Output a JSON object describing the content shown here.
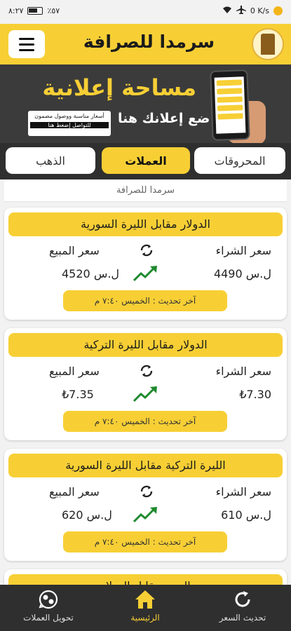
{
  "status_bar": {
    "time": "٨:٢٧",
    "battery": "٪٥٧",
    "speed": "0 K/s"
  },
  "app_bar": {
    "title": "سرمدا للصرافة"
  },
  "ad": {
    "headline": "مساحة إعلانية",
    "cta": "ضع إعلانك هنا",
    "small_line1": "أسعار مناسبة ووصول مضمون",
    "small_line2": "للتواصل إضغط هنا"
  },
  "tabs": [
    {
      "label": "المحروقات"
    },
    {
      "label": "العملات"
    },
    {
      "label": "الذهب"
    }
  ],
  "subheader": "سرمدا للصرافة",
  "labels": {
    "buy": "سعر الشراء",
    "sell": "سعر المبيع"
  },
  "cards": [
    {
      "title": "الدولار مقابل الليرة السورية",
      "buy": "4490 ل.س",
      "sell": "4520 ل.س",
      "updated": "آخر تحديث : الخميس ٧:٤٠ م"
    },
    {
      "title": "الدولار مقابل الليرة التركية",
      "buy": "₺7.30",
      "sell": "₺7.35",
      "updated": "آخر تحديث : الخميس ٧:٤٠ م"
    },
    {
      "title": "الليرة التركية مقابل الليرة السورية",
      "buy": "610 ل.س",
      "sell": "620 ل.س",
      "updated": "آخر تحديث : الخميس ٧:٤٠ م"
    },
    {
      "title": "اليورو مقابل الدولار",
      "buy": "",
      "sell": "",
      "updated": ""
    }
  ],
  "bottom_nav": [
    {
      "label": "تحويل العملات"
    },
    {
      "label": "الرئيسية"
    },
    {
      "label": "تحديث السعر"
    }
  ],
  "colors": {
    "accent": "#f7cf35",
    "dark": "#2f2f2f",
    "trend_up": "#1f8a2e"
  }
}
